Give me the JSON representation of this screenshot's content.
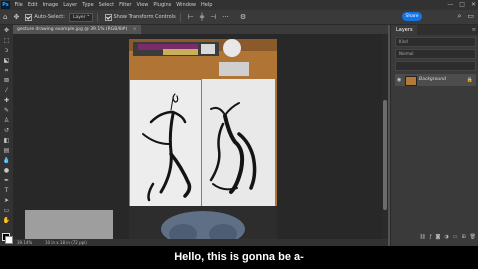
{
  "menubar": {
    "app_logo": "Ps",
    "items": [
      "File",
      "Edit",
      "Image",
      "Layer",
      "Type",
      "Select",
      "Filter",
      "View",
      "Plugins",
      "Window",
      "Help"
    ],
    "window_controls": [
      "—",
      "□",
      "✕"
    ]
  },
  "options": {
    "auto_select_label": "Auto-Select:",
    "auto_select_value": "Layer",
    "transform_label": "Show Transform Controls",
    "share_label": "Share"
  },
  "document": {
    "tab_title": "gesture drawing example.jpg @ 39.1% (RGB/8#)",
    "close": "×"
  },
  "status": {
    "zoom": "39.14%",
    "size": "10 in x 18 in (72 ppi)"
  },
  "layers_panel": {
    "tab": "Layers",
    "menu_icon": "≡",
    "kind_label": "Kind",
    "blend_label": "Normal",
    "layer_name": "Background"
  },
  "caption": "Hello, this is gonna be a-"
}
